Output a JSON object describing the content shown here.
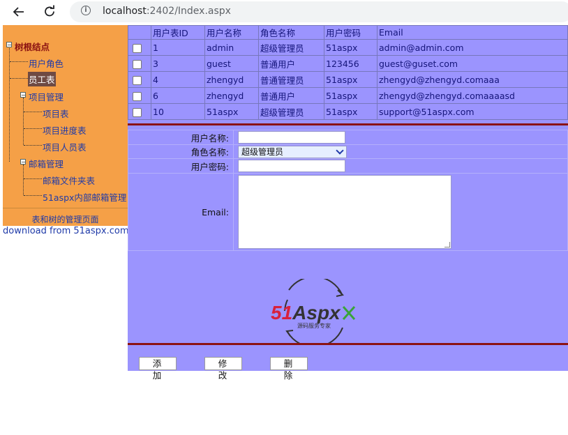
{
  "browser": {
    "url_host": "localhost",
    "url_rest": ":2402/Index.aspx"
  },
  "tree": {
    "root": "树根结点",
    "items": [
      {
        "label": "用户角色"
      },
      {
        "label": "员工表"
      },
      {
        "label": "项目管理"
      },
      {
        "label": "项目表"
      },
      {
        "label": "项目进度表"
      },
      {
        "label": "项目人员表"
      },
      {
        "label": "邮箱管理"
      },
      {
        "label": "邮箱文件夹表"
      },
      {
        "label": "51aspx内部邮箱管理"
      }
    ],
    "caption": "表和树的管理页面"
  },
  "download_text": "download from 51aspx.com",
  "grid": {
    "headers": [
      "",
      "用户表ID",
      "用户名称",
      "角色名称",
      "用户密码",
      "Email"
    ],
    "rows": [
      {
        "id": "1",
        "name": "admin",
        "role": "超级管理员",
        "pwd": "51aspx",
        "email": "admin@admin.com"
      },
      {
        "id": "3",
        "name": "guest",
        "role": "普通用户",
        "pwd": "123456",
        "email": "guest@guset.com"
      },
      {
        "id": "4",
        "name": "zhengyd",
        "role": "普通管理员",
        "pwd": "51aspx",
        "email": "zhengyd@zhengyd.comaaa"
      },
      {
        "id": "6",
        "name": "zhengyd",
        "role": "普通用户",
        "pwd": "51aspx",
        "email": "zhengyd@zhengyd.comaaaasd"
      },
      {
        "id": "10",
        "name": "51aspx",
        "role": "超级管理员",
        "pwd": "51aspx",
        "email": "support@51aspx.com"
      }
    ]
  },
  "form": {
    "username_label": "用户名称:",
    "role_label": "角色名称:",
    "role_value": "超级管理员",
    "password_label": "用户密码:",
    "email_label": "Email:"
  },
  "logo": {
    "brand": "51Aspx",
    "brand_num": "51",
    "brand_text": "Aspx",
    "tagline": "源码服务专家",
    "red": "#d8213b",
    "green": "#3aa33a"
  },
  "buttons": {
    "add": "添加",
    "edit": "修改",
    "delete": "删除"
  },
  "colors": {
    "panel_orange": "#f5a047",
    "panel_purple": "#9b94fe",
    "separator_red": "#8b1313"
  }
}
